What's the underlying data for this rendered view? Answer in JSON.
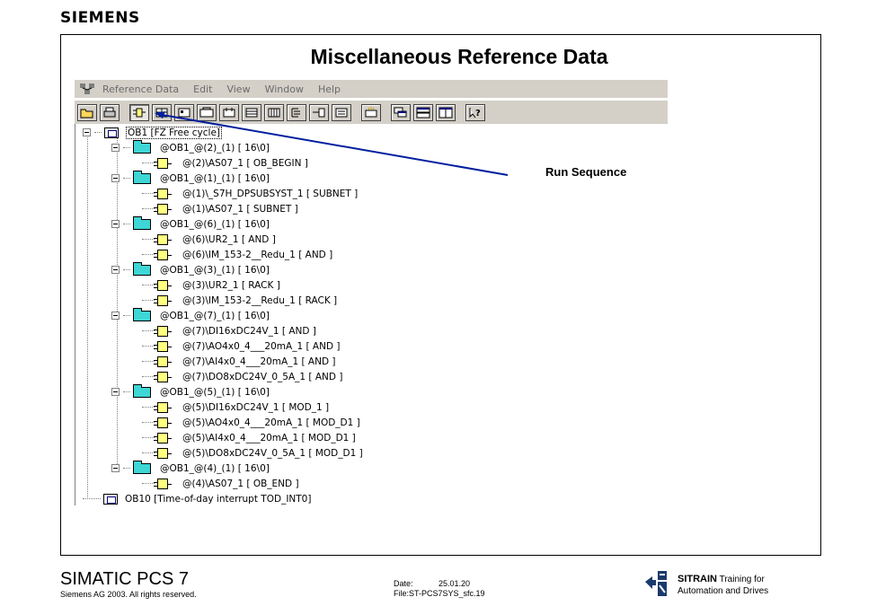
{
  "header": {
    "logo": "SIEMENS",
    "title": "Miscellaneous Reference Data"
  },
  "menubar": {
    "items": [
      "Reference Data",
      "Edit",
      "View",
      "Window",
      "Help"
    ]
  },
  "toolbar": {
    "buttons": [
      "open-icon",
      "print-icon",
      "run-sequence-icon",
      "cross-ref-icon",
      "assignment-icon",
      "program-structure-icon",
      "unused-symbols-icon",
      "table-icon",
      "tree-icon",
      "filter-icon",
      "list-icon",
      "new-window-icon",
      "cascade-icon",
      "tile-horizontal-icon",
      "tile-vertical-icon",
      "help-icon"
    ]
  },
  "annotation": {
    "label": "Run Sequence",
    "arrow_color": "#001f9e"
  },
  "tree": {
    "nodes": [
      {
        "level": 0,
        "kind": "ob",
        "text": "OB1 [FZ Free cycle]"
      },
      {
        "level": 1,
        "kind": "folder",
        "text": "@OB1_@(2)_(1) [ 16\\0]"
      },
      {
        "level": 2,
        "kind": "block",
        "text": "@(2)\\AS07_1 [ OB_BEGIN ]"
      },
      {
        "level": 1,
        "kind": "folder",
        "text": "@OB1_@(1)_(1) [ 16\\0]"
      },
      {
        "level": 2,
        "kind": "block",
        "text": "@(1)\\_S7H_DPSUBSYST_1 [ SUBNET ]"
      },
      {
        "level": 2,
        "kind": "block",
        "text": "@(1)\\AS07_1 [ SUBNET ]"
      },
      {
        "level": 1,
        "kind": "folder",
        "text": "@OB1_@(6)_(1) [ 16\\0]"
      },
      {
        "level": 2,
        "kind": "block",
        "text": "@(6)\\UR2_1 [ AND ]"
      },
      {
        "level": 2,
        "kind": "block",
        "text": "@(6)\\IM_153-2__Redu_1 [ AND ]"
      },
      {
        "level": 1,
        "kind": "folder",
        "text": "@OB1_@(3)_(1) [ 16\\0]"
      },
      {
        "level": 2,
        "kind": "block",
        "text": "@(3)\\UR2_1 [ RACK ]"
      },
      {
        "level": 2,
        "kind": "block",
        "text": "@(3)\\IM_153-2__Redu_1 [ RACK ]"
      },
      {
        "level": 1,
        "kind": "folder",
        "text": "@OB1_@(7)_(1) [ 16\\0]"
      },
      {
        "level": 2,
        "kind": "block",
        "text": "@(7)\\DI16xDC24V_1 [ AND ]"
      },
      {
        "level": 2,
        "kind": "block",
        "text": "@(7)\\AO4x0_4___20mA_1 [ AND ]"
      },
      {
        "level": 2,
        "kind": "block",
        "text": "@(7)\\AI4x0_4___20mA_1 [ AND ]"
      },
      {
        "level": 2,
        "kind": "block",
        "text": "@(7)\\DO8xDC24V_0_5A_1 [ AND ]"
      },
      {
        "level": 1,
        "kind": "folder",
        "text": "@OB1_@(5)_(1) [ 16\\0]"
      },
      {
        "level": 2,
        "kind": "block",
        "text": "@(5)\\DI16xDC24V_1 [ MOD_1 ]"
      },
      {
        "level": 2,
        "kind": "block",
        "text": "@(5)\\AO4x0_4___20mA_1 [ MOD_D1 ]"
      },
      {
        "level": 2,
        "kind": "block",
        "text": "@(5)\\AI4x0_4___20mA_1 [ MOD_D1 ]"
      },
      {
        "level": 2,
        "kind": "block",
        "text": "@(5)\\DO8xDC24V_0_5A_1 [ MOD_D1 ]"
      },
      {
        "level": 1,
        "kind": "folder",
        "text": "@OB1_@(4)_(1) [ 16\\0]"
      },
      {
        "level": 2,
        "kind": "block",
        "text": "@(4)\\AS07_1 [ OB_END ]"
      },
      {
        "level": 0,
        "kind": "ob-leaf",
        "text": "OB10 [Time-of-day interrupt TOD_INT0]"
      }
    ]
  },
  "footer": {
    "product": "SIMATIC PCS 7",
    "copyright": "Siemens AG 2003. All rights reserved.",
    "date_label": "Date:",
    "date_value": "25.01.20",
    "file": "File:ST-PCS7SYS_sfc.19",
    "brand": "SITRAIN",
    "brand_suffix": "Training for",
    "brand_line2": "Automation and Drives"
  }
}
